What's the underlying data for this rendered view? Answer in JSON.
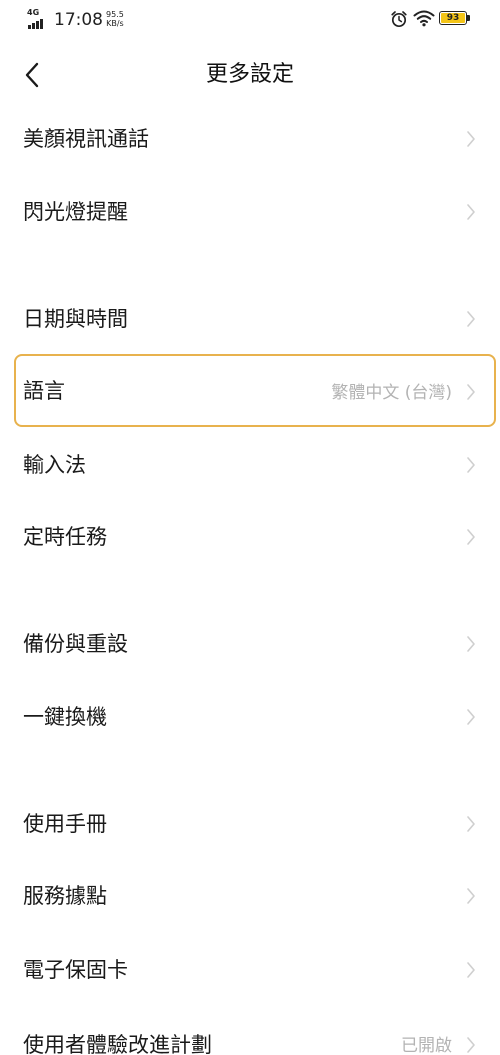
{
  "status_bar": {
    "network_type": "4G",
    "time": "17:08",
    "net_speed_value": "95.5",
    "net_speed_unit": "KB/s",
    "battery_level": "93",
    "battery_color": "#f4c518",
    "icons": [
      "signal-icon",
      "alarm-icon",
      "wifi-icon",
      "battery-icon"
    ]
  },
  "header": {
    "back_icon": "chevron-left-icon",
    "title": "更多設定"
  },
  "colors": {
    "highlight_border": "#e8b24d",
    "value_text": "#b3b3b3",
    "chevron": "#cfcfcf"
  },
  "settings": {
    "items": [
      {
        "label": "美顏視訊通話",
        "value": ""
      },
      {
        "label": "閃光燈提醒",
        "value": ""
      },
      {
        "label": "日期與時間",
        "value": ""
      },
      {
        "label": "語言",
        "value": "繁體中文 (台灣)",
        "highlighted": true
      },
      {
        "label": "輸入法",
        "value": ""
      },
      {
        "label": "定時任務",
        "value": ""
      },
      {
        "label": "備份與重設",
        "value": ""
      },
      {
        "label": "一鍵換機",
        "value": ""
      },
      {
        "label": "使用手冊",
        "value": ""
      },
      {
        "label": "服務據點",
        "value": ""
      },
      {
        "label": "電子保固卡",
        "value": ""
      },
      {
        "label": "使用者體驗改進計劃",
        "value": "已開啟"
      }
    ]
  }
}
